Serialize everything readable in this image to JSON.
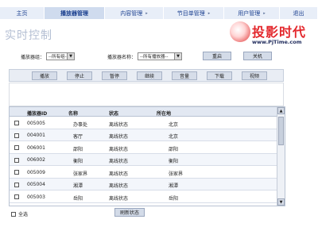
{
  "nav": {
    "items": [
      {
        "label": "主页",
        "arrow": ""
      },
      {
        "label": "播放器管理",
        "arrow": ""
      },
      {
        "label": "内容管理",
        "arrow": "▸"
      },
      {
        "label": "节目单管理",
        "arrow": "▸"
      },
      {
        "label": "用户管理",
        "arrow": "▸"
      },
      {
        "label": "退出",
        "arrow": ""
      }
    ]
  },
  "header": {
    "title": "实时控制",
    "logo_text": "投影时代",
    "logo_url": "www.PjTime.com"
  },
  "filters": {
    "group_label": "播放器组：",
    "group_value": "--所有组--",
    "name_label": "播放器名称：",
    "name_value": "--所有播放器--",
    "refresh_label": "重启",
    "shutdown_label": "关机"
  },
  "toolbar": {
    "buttons": [
      "播放",
      "停止",
      "暂停",
      "继续",
      "音量",
      "下载",
      "视频"
    ]
  },
  "table": {
    "headers": [
      "播放器ID",
      "名称",
      "状态",
      "所在地"
    ],
    "rows": [
      {
        "id": "005005",
        "name": "办事处",
        "status": "离线状态",
        "location": "北京"
      },
      {
        "id": "004001",
        "name": "客厅",
        "status": "离线状态",
        "location": "北京"
      },
      {
        "id": "006001",
        "name": "邵阳",
        "status": "离线状态",
        "location": "邵阳"
      },
      {
        "id": "006002",
        "name": "衡阳",
        "status": "离线状态",
        "location": "衡阳"
      },
      {
        "id": "005009",
        "name": "张家界",
        "status": "离线状态",
        "location": "张家界"
      },
      {
        "id": "005004",
        "name": "湘潭",
        "status": "离线状态",
        "location": "湘潭"
      },
      {
        "id": "005003",
        "name": "岳阳",
        "status": "离线状态",
        "location": "岳阳"
      }
    ]
  },
  "footer": {
    "select_all": "全选",
    "refresh_status": "刷新状态"
  }
}
